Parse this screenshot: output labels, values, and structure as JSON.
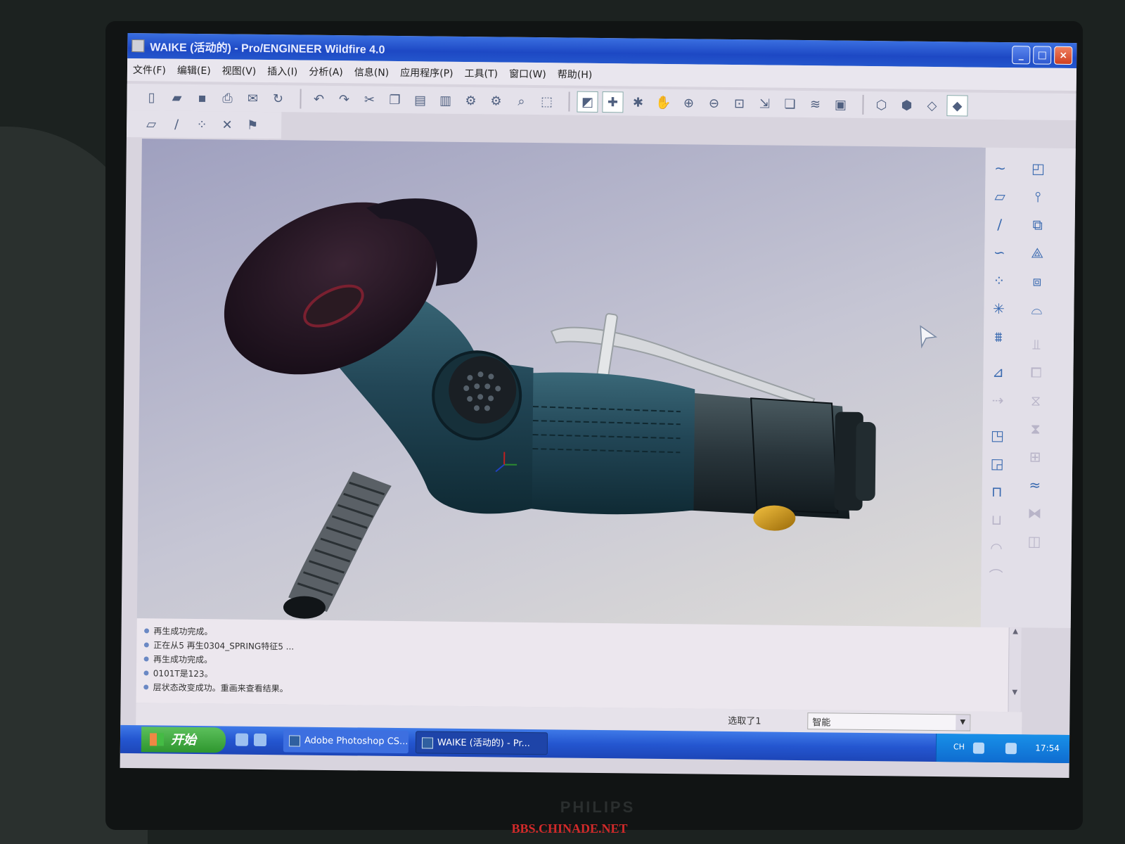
{
  "window": {
    "title": "WAIKE (活动的) - Pro/ENGINEER Wildfire 4.0",
    "controls": {
      "minimize": "_",
      "maximize": "□",
      "close": "×"
    }
  },
  "menu": [
    "文件(F)",
    "编辑(E)",
    "视图(V)",
    "插入(I)",
    "分析(A)",
    "信息(N)",
    "应用程序(P)",
    "工具(T)",
    "窗口(W)",
    "帮助(H)"
  ],
  "messages": [
    "再生成功完成。",
    "正在从5 再生0304_SPRING特征5 ...",
    "再生成功完成。",
    "0101T是123。",
    "层状态改变成功。重画来查看结果。"
  ],
  "status": {
    "selected": "选取了1",
    "filter_value": "智能"
  },
  "taskbar": {
    "start_label": "开始",
    "tasks": [
      "Adobe Photoshop CS...",
      "WAIKE (活动的) - Pr..."
    ],
    "lang": "CH",
    "clock": "17:54"
  },
  "monitor": {
    "brand": "PHILIPS",
    "watermark": "BBS.CHINADE.NET"
  },
  "colors": {
    "tool_body": "#1f4150",
    "tool_body_light": "#3a6878",
    "disc": "#221522",
    "fitting": "#2a3438",
    "knob": "#c89018",
    "titlebar": "#1d48c4",
    "taskbar": "#2456d0"
  },
  "icons": {
    "toolbar": [
      "new-file-icon",
      "open-folder-icon",
      "save-icon",
      "print-icon",
      "email-icon",
      "regenerate-icon",
      "undo-icon",
      "redo-icon",
      "cut-icon",
      "copy-icon",
      "paste-icon",
      "paste-special-icon",
      "regenerate-model-icon",
      "regen-manager-icon",
      "find-icon",
      "select-box-icon",
      "repaint-icon",
      "spin-center-icon",
      "orient-mode-icon",
      "pan-icon",
      "zoom-in-icon",
      "zoom-out-icon",
      "refit-icon",
      "reorient-icon",
      "saved-views-icon",
      "layers-icon",
      "view-manager-icon",
      "wireframe-icon",
      "hidden-line-icon",
      "no-hidden-icon",
      "shading-icon"
    ],
    "toolbar2": [
      "datum-plane-icon",
      "datum-axis-icon",
      "datum-point-icon",
      "csys-icon",
      "annotation-icon"
    ],
    "right": [
      "datum-curve-icon",
      "datum-plane-tool-icon",
      "datum-axis-tool-icon",
      "sketch-curve-icon",
      "datum-point-tool-icon",
      "csys-tool-icon",
      "analysis-tool-icon",
      "note-icon",
      "extrude-icon",
      "revolve-icon",
      "rib-icon",
      "hole-icon",
      "shell-icon",
      "round-icon",
      "chamfer-icon",
      "draft-icon",
      "pattern-icon",
      "mirror-icon",
      "merge-icon",
      "trim-icon",
      "offset-icon",
      "thicken-icon",
      "solidify-icon",
      "warp-icon",
      "style-icon",
      "copy-tool-icon",
      "paste-tool-icon",
      "select-icon"
    ]
  }
}
